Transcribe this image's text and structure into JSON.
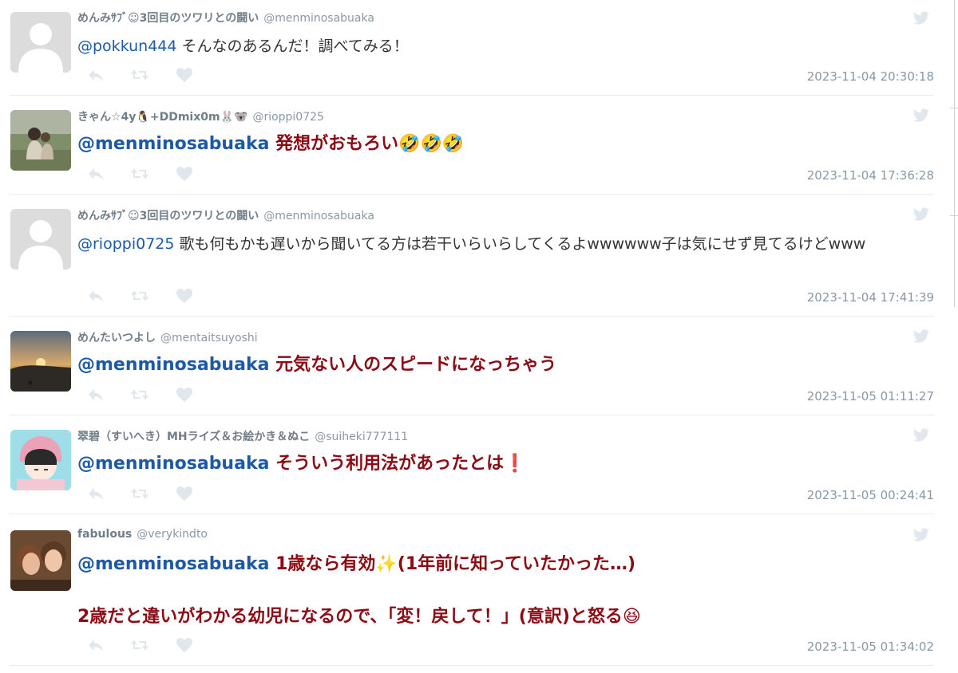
{
  "tweets": [
    {
      "name": "めんみｻﾌﾞ☺3回目のツワリとの闘い",
      "handle": "@menminosabuaka",
      "mention": "@pokkun444",
      "text": " そんなのあるんだ！調べてみる！",
      "timestamp": "2023-11-04 20:30:18",
      "style": "normal",
      "avatar": "default-avatar"
    },
    {
      "name": "きゃん☆4y🐧+DDmix0m🐰🐨",
      "handle": "@rioppi0725",
      "mention": "@menminosabuaka",
      "text": " 発想がおもろい🤣🤣🤣",
      "timestamp": "2023-11-04 17:36:28",
      "style": "bold",
      "avatar": "photo-avatar"
    },
    {
      "name": "めんみｻﾌﾞ☺3回目のツワリとの闘い",
      "handle": "@menminosabuaka",
      "mention": "@rioppi0725",
      "text": " 歌も何もかも遅いから聞いてる方は若干いらいらしてくるよwwwwww子は気にせず見てるけどwww",
      "timestamp": "2023-11-04 17:41:39",
      "style": "normal",
      "avatar": "default-avatar"
    },
    {
      "name": "めんたいつよし",
      "handle": "@mentaitsuyoshi",
      "mention": "@menminosabuaka",
      "text": " 元気ない人のスピードになっちゃう",
      "timestamp": "2023-11-05 01:11:27",
      "style": "bold",
      "avatar": "sunset-avatar"
    },
    {
      "name": "翠碧（すいへき）MHライズ＆お絵かき＆ぬこ",
      "handle": "@suiheki777111",
      "mention": "@menminosabuaka",
      "text": " そういう利用法があったとは❗",
      "timestamp": "2023-11-05 00:24:41",
      "style": "bold",
      "avatar": "illustration-avatar"
    },
    {
      "name": "fabulous",
      "handle": "@verykindto",
      "mention": "@menminosabuaka",
      "text": " 1歳なら有効✨(1年前に知っていたかった…)",
      "text2": "2歳だと違いがわかる幼児になるので、「変！戻して！」(意訳)と怒る😆",
      "timestamp": "2023-11-05 01:34:02",
      "style": "bold",
      "avatar": "kids-photo-avatar"
    }
  ],
  "icons": {
    "reply": "reply-icon",
    "retweet": "retweet-icon",
    "like": "heart-icon",
    "source": "twitter-bird-icon"
  },
  "colors": {
    "mention": "#1c5aa8",
    "bold_text": "#8b0a14",
    "meta": "#8899a6",
    "action_icon": "#e1e8ed",
    "divider": "#e6ecf0"
  }
}
